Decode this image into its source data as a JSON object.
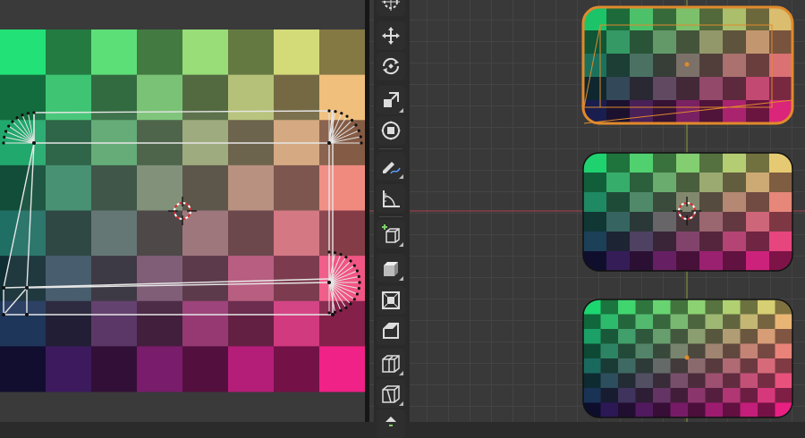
{
  "colors": {
    "uv_background": "#3a3a3a",
    "viewport_background": "#393939",
    "selection_orange": "#e08a2c",
    "x_axis_red": "#b04050",
    "y_axis_green": "#8aa040",
    "edge_white": "#e6e6e6"
  },
  "uv_editor": {
    "texture": "checker-gradient",
    "cursor_icon": "2d-cursor-icon"
  },
  "viewport": {
    "objects": [
      {
        "name": "rounded-panel-top",
        "selected": true
      },
      {
        "name": "rounded-panel-middle",
        "selected": false
      },
      {
        "name": "rounded-panel-bottom",
        "selected": false
      }
    ],
    "cursor_icon": "3d-cursor-icon"
  },
  "toolbar": {
    "tools": [
      {
        "icon": "cursor-tool-icon",
        "active": false,
        "has_submenu": false
      },
      {
        "icon": "move-tool-icon",
        "active": false,
        "has_submenu": false
      },
      {
        "icon": "rotate-tool-icon",
        "active": false,
        "has_submenu": false
      },
      {
        "icon": "scale-tool-icon",
        "active": false,
        "has_submenu": true
      },
      {
        "icon": "transform-tool-icon",
        "active": false,
        "has_submenu": false
      },
      {
        "icon": "annotate-tool-icon",
        "active": false,
        "has_submenu": true
      },
      {
        "icon": "measure-tool-icon",
        "active": false,
        "has_submenu": false
      },
      {
        "icon": "add-cube-tool-icon",
        "active": false,
        "has_submenu": true
      },
      {
        "icon": "extrude-tool-icon",
        "active": false,
        "has_submenu": true
      },
      {
        "icon": "inset-tool-icon",
        "active": false,
        "has_submenu": false
      },
      {
        "icon": "bevel-tool-icon",
        "active": false,
        "has_submenu": false
      },
      {
        "icon": "loop-cut-tool-icon",
        "active": false,
        "has_submenu": true
      },
      {
        "icon": "knife-tool-icon",
        "active": false,
        "has_submenu": true
      },
      {
        "icon": "poly-build-tool-icon",
        "active": false,
        "has_submenu": false
      }
    ]
  }
}
